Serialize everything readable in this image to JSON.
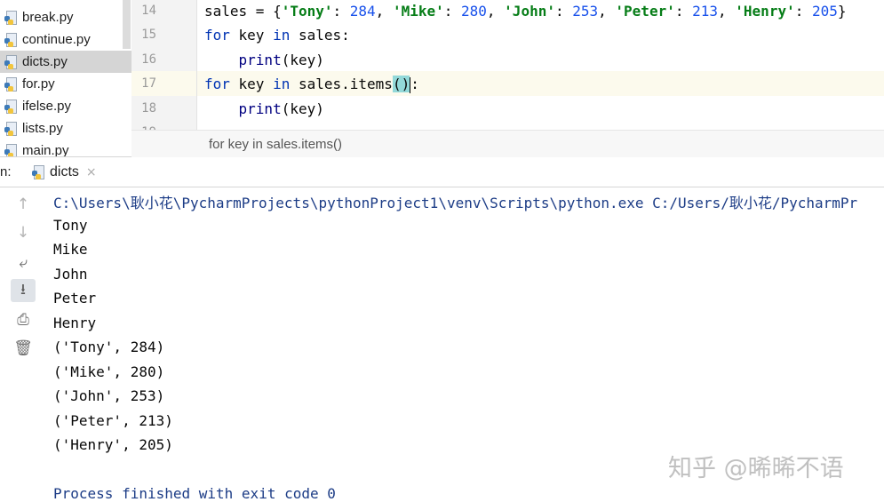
{
  "project_tree": {
    "items": [
      {
        "label": "break.py",
        "selected": false
      },
      {
        "label": "continue.py",
        "selected": false
      },
      {
        "label": "dicts.py",
        "selected": true
      },
      {
        "label": "for.py",
        "selected": false
      },
      {
        "label": "ifelse.py",
        "selected": false
      },
      {
        "label": "lists.py",
        "selected": false
      },
      {
        "label": "main.py",
        "selected": false
      }
    ]
  },
  "editor": {
    "line_numbers": [
      "14",
      "15",
      "16",
      "17",
      "18",
      "19"
    ],
    "current_line": "17",
    "line14": {
      "var": "sales",
      "op": " = {",
      "k1": "'Tony'",
      "v1": "284",
      "k2": "'Mike'",
      "v2": "280",
      "k3": "'John'",
      "v3": "253",
      "k4": "'Peter'",
      "v4": "213",
      "k5": "'Henry'",
      "v5": "205",
      "sep": ": ",
      "comma": ", ",
      "close": "}"
    },
    "line15": {
      "kw_for": "for",
      "var": " key ",
      "kw_in": "in",
      "rest": " sales:"
    },
    "line16": {
      "indent": "    ",
      "fn": "print",
      "args": "(key)"
    },
    "line17": {
      "kw_for": "for",
      "var": " key ",
      "kw_in": "in",
      "obj": " sales.items",
      "parens": "()",
      "colon": ":"
    },
    "line18": {
      "indent": "    ",
      "fn": "print",
      "args": "(key)"
    },
    "breadcrumb": "for key in sales.items()"
  },
  "run_panel": {
    "label": "n:",
    "tab_label": "dicts",
    "close_glyph": "×",
    "toolbar_icons": [
      "up-arrow-icon",
      "down-arrow-icon",
      "soft-wrap-icon",
      "scroll-to-end-icon",
      "print-icon",
      "trash-icon"
    ],
    "toolbar_glyphs": {
      "up": "↑",
      "down": "↓",
      "wrap": "⤶",
      "scroll_end": "⭳",
      "print": "⎙",
      "trash": "🗑"
    }
  },
  "console": {
    "command": "C:\\Users\\耿小花\\PycharmProjects\\pythonProject1\\venv\\Scripts\\python.exe C:/Users/耿小花/PycharmPr",
    "lines": [
      "Tony",
      "Mike",
      "John",
      "Peter",
      "Henry",
      "('Tony', 284)",
      "('Mike', 280)",
      "('John', 253)",
      "('Peter', 213)",
      "('Henry', 205)"
    ],
    "exit_message": "Process finished with exit code 0"
  },
  "watermark": "知乎 @晞晞不语",
  "colors": {
    "keyword": "#0033b3",
    "string": "#067d17",
    "number": "#1750eb",
    "selection": "#d5d5d5",
    "brace_highlight": "#93d9d9"
  }
}
